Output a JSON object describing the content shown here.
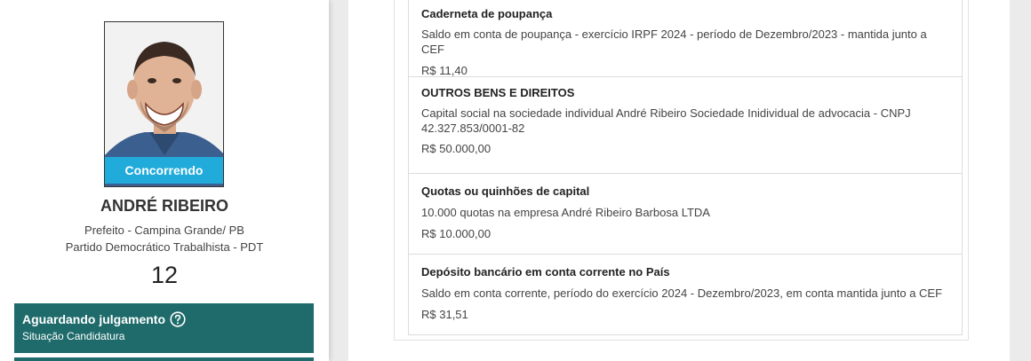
{
  "candidate": {
    "badge": "Concorrendo",
    "name": "ANDRÉ RIBEIRO",
    "office": "Prefeito - Campina Grande/ PB",
    "party": "Partido Democrático Trabalhista - PDT",
    "number": "12",
    "status_title": "Aguardando julgamento",
    "status_subtitle": "Situação Candidatura",
    "status_icon": "help-circle-icon"
  },
  "assets": [
    {
      "title": "Caderneta de poupança",
      "description": "Saldo em conta de poupança - exercício IRPF 2024 - período de Dezembro/2023 - mantida junto a CEF",
      "value": "R$ 11,40"
    },
    {
      "title": "OUTROS BENS E DIREITOS",
      "description": "Capital social na sociedade individual André Ribeiro Sociedade Inidividual de advocacia - CNPJ 42.327.853/0001-82",
      "value": "R$ 50.000,00"
    },
    {
      "title": "Quotas ou quinhões de capital",
      "description": "10.000 quotas na empresa André Ribeiro Barbosa LTDA",
      "value": "R$ 10.000,00"
    },
    {
      "title": "Depósito bancário em conta corrente no País",
      "description": "Saldo em conta corrente, período do exercício 2024 - Dezembro/2023, em conta mantida junto a CEF",
      "value": "R$ 31,51"
    }
  ],
  "colors": {
    "status_bg": "#1f6b6b",
    "badge_bg": "#20b2e2"
  }
}
